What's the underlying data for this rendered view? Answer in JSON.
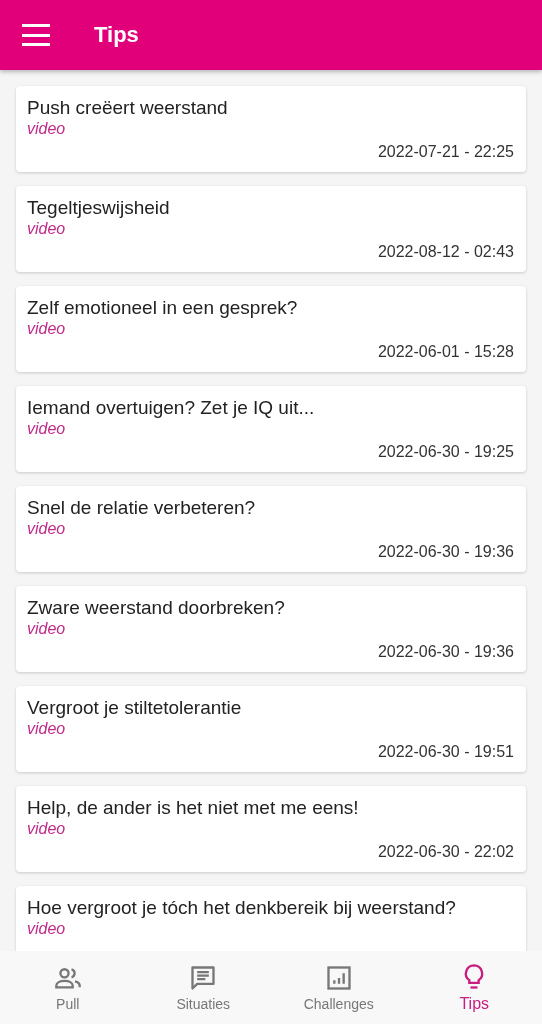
{
  "app_bar": {
    "title": "Tips"
  },
  "tips": [
    {
      "title": "Push creëert weerstand",
      "type": "video",
      "date": "2022-07-21 - 22:25"
    },
    {
      "title": "Tegeltjeswijsheid",
      "type": "video",
      "date": "2022-08-12 - 02:43"
    },
    {
      "title": "Zelf emotioneel in een gesprek?",
      "type": "video",
      "date": "2022-06-01 - 15:28"
    },
    {
      "title": "Iemand overtuigen? Zet je IQ uit...",
      "type": "video",
      "date": "2022-06-30 - 19:25"
    },
    {
      "title": "Snel de relatie verbeteren?",
      "type": "video",
      "date": "2022-06-30 - 19:36"
    },
    {
      "title": "Zware weerstand doorbreken?",
      "type": "video",
      "date": "2022-06-30 - 19:36"
    },
    {
      "title": "Vergroot je stiltetolerantie",
      "type": "video",
      "date": "2022-06-30 - 19:51"
    },
    {
      "title": "Help, de ander is het niet met me eens!",
      "type": "video",
      "date": "2022-06-30 - 22:02"
    },
    {
      "title": "Hoe vergroot je tóch het denkbereik bij weerstand?",
      "type": "video"
    }
  ],
  "bottom_nav": [
    {
      "label": "Pull",
      "selected": false
    },
    {
      "label": "Situaties",
      "selected": false
    },
    {
      "label": "Challenges",
      "selected": false
    },
    {
      "label": "Tips",
      "selected": true
    }
  ]
}
